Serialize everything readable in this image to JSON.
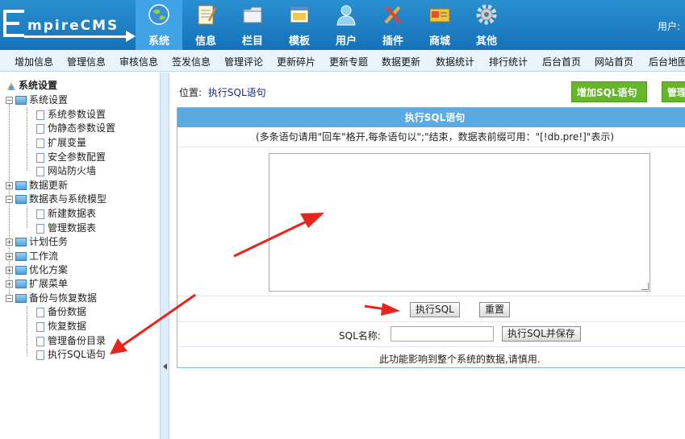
{
  "header": {
    "logo_text": "mpireCMS",
    "user_label": "用户:",
    "nav": [
      {
        "label": "系统",
        "icon": "globe-icon",
        "active": true
      },
      {
        "label": "信息",
        "icon": "notepad-icon",
        "active": false
      },
      {
        "label": "栏目",
        "icon": "folder-icon",
        "active": false
      },
      {
        "label": "模板",
        "icon": "window-icon",
        "active": false
      },
      {
        "label": "用户",
        "icon": "user-icon",
        "active": false
      },
      {
        "label": "插件",
        "icon": "tools-icon",
        "active": false
      },
      {
        "label": "商城",
        "icon": "card-icon",
        "active": false
      },
      {
        "label": "其他",
        "icon": "gear-icon",
        "active": false
      }
    ]
  },
  "menubar": [
    "增加信息",
    "管理信息",
    "审核信息",
    "签发信息",
    "管理评论",
    "更新碎片",
    "更新专题",
    "数据更新",
    "数据统计",
    "排行统计",
    "后台首页",
    "网站首页",
    "后台地图"
  ],
  "tree": {
    "root": "系统设置",
    "items": [
      {
        "label": "系统设置",
        "type": "folder",
        "expanded": true
      },
      {
        "label": "系统参数设置",
        "type": "leaf"
      },
      {
        "label": "伪静态参数设置",
        "type": "leaf"
      },
      {
        "label": "扩展变量",
        "type": "leaf"
      },
      {
        "label": "安全参数配置",
        "type": "leaf"
      },
      {
        "label": "网站防火墙",
        "type": "leaf"
      },
      {
        "label": "数据更新",
        "type": "folder",
        "expanded": false
      },
      {
        "label": "数据表与系统模型",
        "type": "folder",
        "expanded": true
      },
      {
        "label": "新建数据表",
        "type": "leaf"
      },
      {
        "label": "管理数据表",
        "type": "leaf"
      },
      {
        "label": "计划任务",
        "type": "folder",
        "expanded": false
      },
      {
        "label": "工作流",
        "type": "folder",
        "expanded": false
      },
      {
        "label": "优化方案",
        "type": "folder",
        "expanded": false
      },
      {
        "label": "扩展菜单",
        "type": "folder",
        "expanded": false
      },
      {
        "label": "备份与恢复数据",
        "type": "folder",
        "expanded": true
      },
      {
        "label": "备份数据",
        "type": "leaf"
      },
      {
        "label": "恢复数据",
        "type": "leaf"
      },
      {
        "label": "管理备份目录",
        "type": "leaf"
      },
      {
        "label": "执行SQL语句",
        "type": "leaf"
      }
    ]
  },
  "content": {
    "position_label": "位置:",
    "position_link": "执行SQL语句",
    "add_sql_button": "增加SQL语句",
    "manage_button": "管理",
    "panel_title": "执行SQL语句",
    "hint": "(多条语句请用\"回车\"格开,每条语句以\";\"结束，数据表前缀可用：\"[!db.pre!]\"表示)",
    "sql_textarea_value": "",
    "execute_button": "执行SQL",
    "reset_button": "重置",
    "sql_name_label": "SQL名称:",
    "sql_name_value": "",
    "execute_save_button": "执行SQL并保存",
    "warning": "此功能影响到整个系统的数据,请慎用."
  },
  "colors": {
    "header": "#1a7bc2",
    "active_nav": "#3fa3e6",
    "menubar": "#e8f3fb",
    "panel_head": "#5aaae4",
    "green_button": "#67b52a",
    "annotation_arrow": "#e8241c"
  }
}
